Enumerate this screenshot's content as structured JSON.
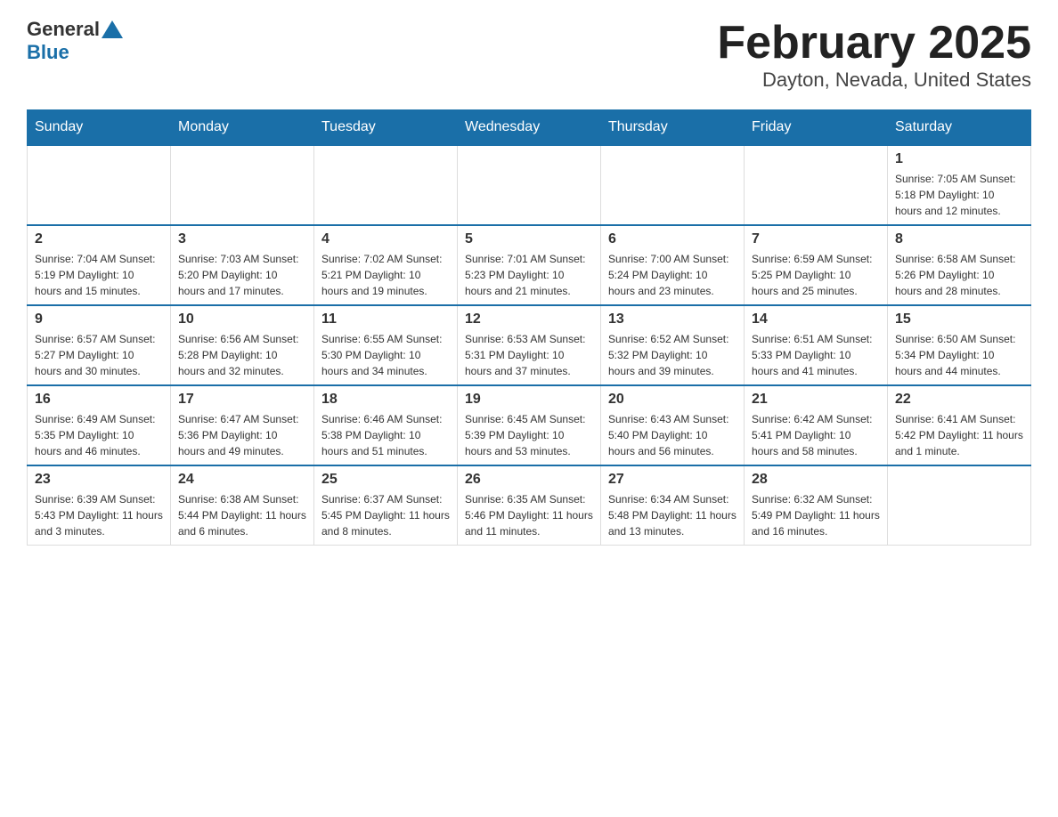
{
  "logo": {
    "general": "General",
    "blue": "Blue"
  },
  "title": "February 2025",
  "subtitle": "Dayton, Nevada, United States",
  "days_of_week": [
    "Sunday",
    "Monday",
    "Tuesday",
    "Wednesday",
    "Thursday",
    "Friday",
    "Saturday"
  ],
  "weeks": [
    [
      {
        "day": "",
        "info": ""
      },
      {
        "day": "",
        "info": ""
      },
      {
        "day": "",
        "info": ""
      },
      {
        "day": "",
        "info": ""
      },
      {
        "day": "",
        "info": ""
      },
      {
        "day": "",
        "info": ""
      },
      {
        "day": "1",
        "info": "Sunrise: 7:05 AM\nSunset: 5:18 PM\nDaylight: 10 hours and 12 minutes."
      }
    ],
    [
      {
        "day": "2",
        "info": "Sunrise: 7:04 AM\nSunset: 5:19 PM\nDaylight: 10 hours and 15 minutes."
      },
      {
        "day": "3",
        "info": "Sunrise: 7:03 AM\nSunset: 5:20 PM\nDaylight: 10 hours and 17 minutes."
      },
      {
        "day": "4",
        "info": "Sunrise: 7:02 AM\nSunset: 5:21 PM\nDaylight: 10 hours and 19 minutes."
      },
      {
        "day": "5",
        "info": "Sunrise: 7:01 AM\nSunset: 5:23 PM\nDaylight: 10 hours and 21 minutes."
      },
      {
        "day": "6",
        "info": "Sunrise: 7:00 AM\nSunset: 5:24 PM\nDaylight: 10 hours and 23 minutes."
      },
      {
        "day": "7",
        "info": "Sunrise: 6:59 AM\nSunset: 5:25 PM\nDaylight: 10 hours and 25 minutes."
      },
      {
        "day": "8",
        "info": "Sunrise: 6:58 AM\nSunset: 5:26 PM\nDaylight: 10 hours and 28 minutes."
      }
    ],
    [
      {
        "day": "9",
        "info": "Sunrise: 6:57 AM\nSunset: 5:27 PM\nDaylight: 10 hours and 30 minutes."
      },
      {
        "day": "10",
        "info": "Sunrise: 6:56 AM\nSunset: 5:28 PM\nDaylight: 10 hours and 32 minutes."
      },
      {
        "day": "11",
        "info": "Sunrise: 6:55 AM\nSunset: 5:30 PM\nDaylight: 10 hours and 34 minutes."
      },
      {
        "day": "12",
        "info": "Sunrise: 6:53 AM\nSunset: 5:31 PM\nDaylight: 10 hours and 37 minutes."
      },
      {
        "day": "13",
        "info": "Sunrise: 6:52 AM\nSunset: 5:32 PM\nDaylight: 10 hours and 39 minutes."
      },
      {
        "day": "14",
        "info": "Sunrise: 6:51 AM\nSunset: 5:33 PM\nDaylight: 10 hours and 41 minutes."
      },
      {
        "day": "15",
        "info": "Sunrise: 6:50 AM\nSunset: 5:34 PM\nDaylight: 10 hours and 44 minutes."
      }
    ],
    [
      {
        "day": "16",
        "info": "Sunrise: 6:49 AM\nSunset: 5:35 PM\nDaylight: 10 hours and 46 minutes."
      },
      {
        "day": "17",
        "info": "Sunrise: 6:47 AM\nSunset: 5:36 PM\nDaylight: 10 hours and 49 minutes."
      },
      {
        "day": "18",
        "info": "Sunrise: 6:46 AM\nSunset: 5:38 PM\nDaylight: 10 hours and 51 minutes."
      },
      {
        "day": "19",
        "info": "Sunrise: 6:45 AM\nSunset: 5:39 PM\nDaylight: 10 hours and 53 minutes."
      },
      {
        "day": "20",
        "info": "Sunrise: 6:43 AM\nSunset: 5:40 PM\nDaylight: 10 hours and 56 minutes."
      },
      {
        "day": "21",
        "info": "Sunrise: 6:42 AM\nSunset: 5:41 PM\nDaylight: 10 hours and 58 minutes."
      },
      {
        "day": "22",
        "info": "Sunrise: 6:41 AM\nSunset: 5:42 PM\nDaylight: 11 hours and 1 minute."
      }
    ],
    [
      {
        "day": "23",
        "info": "Sunrise: 6:39 AM\nSunset: 5:43 PM\nDaylight: 11 hours and 3 minutes."
      },
      {
        "day": "24",
        "info": "Sunrise: 6:38 AM\nSunset: 5:44 PM\nDaylight: 11 hours and 6 minutes."
      },
      {
        "day": "25",
        "info": "Sunrise: 6:37 AM\nSunset: 5:45 PM\nDaylight: 11 hours and 8 minutes."
      },
      {
        "day": "26",
        "info": "Sunrise: 6:35 AM\nSunset: 5:46 PM\nDaylight: 11 hours and 11 minutes."
      },
      {
        "day": "27",
        "info": "Sunrise: 6:34 AM\nSunset: 5:48 PM\nDaylight: 11 hours and 13 minutes."
      },
      {
        "day": "28",
        "info": "Sunrise: 6:32 AM\nSunset: 5:49 PM\nDaylight: 11 hours and 16 minutes."
      },
      {
        "day": "",
        "info": ""
      }
    ]
  ]
}
